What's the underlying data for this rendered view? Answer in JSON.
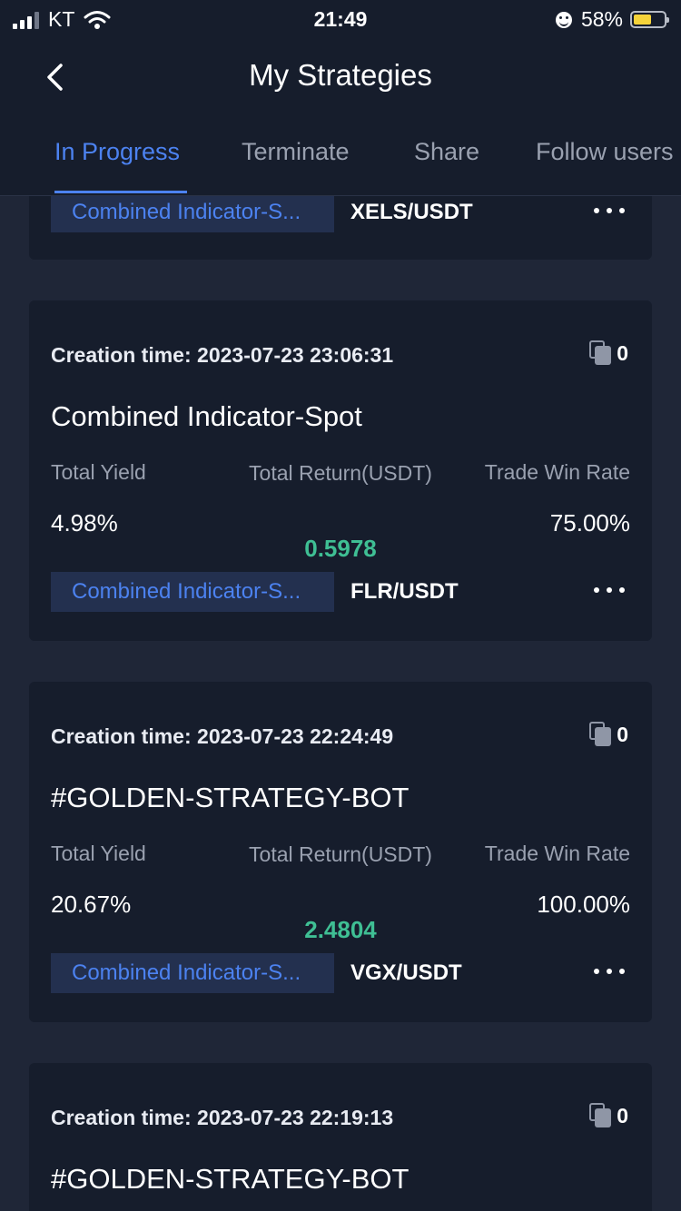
{
  "status_bar": {
    "carrier": "KT",
    "time": "21:49",
    "battery_percent": "58%",
    "battery_level": 0.58,
    "icons": [
      "signal-icon",
      "wifi-icon",
      "face-icon",
      "battery-icon"
    ]
  },
  "nav": {
    "title": "My Strategies",
    "back_icon": "chevron-left-icon"
  },
  "tabs": [
    {
      "label": "In Progress",
      "active": true
    },
    {
      "label": "Terminate",
      "active": false
    },
    {
      "label": "Share",
      "active": false
    },
    {
      "label": "Follow users",
      "active": false
    }
  ],
  "labels": {
    "creation_time": "Creation time:",
    "total_yield": "Total Yield",
    "total_return": "Total Return(USDT)",
    "trade_win_rate": "Trade Win Rate"
  },
  "colors": {
    "accent": "#4c82f0",
    "positive": "#3fbf94",
    "background": "#1f2637",
    "card": "#161d2c"
  },
  "cards": [
    {
      "partial": true,
      "strategy_type": "Combined Indicator-S...",
      "pair": "XELS/USDT"
    },
    {
      "creation_time": "2023-07-23 23:06:31",
      "copies": "0",
      "name": "Combined Indicator-Spot",
      "total_yield": "4.98%",
      "total_return": "0.5978",
      "trade_win_rate": "75.00%",
      "strategy_type": "Combined Indicator-S...",
      "pair": "FLR/USDT"
    },
    {
      "creation_time": "2023-07-23 22:24:49",
      "copies": "0",
      "name": "#GOLDEN-STRATEGY-BOT",
      "total_yield": "20.67%",
      "total_return": "2.4804",
      "trade_win_rate": "100.00%",
      "strategy_type": "Combined Indicator-S...",
      "pair": "VGX/USDT"
    },
    {
      "partial": true,
      "creation_time": "2023-07-23 22:19:13",
      "copies": "0",
      "name": "#GOLDEN-STRATEGY-BOT"
    }
  ]
}
